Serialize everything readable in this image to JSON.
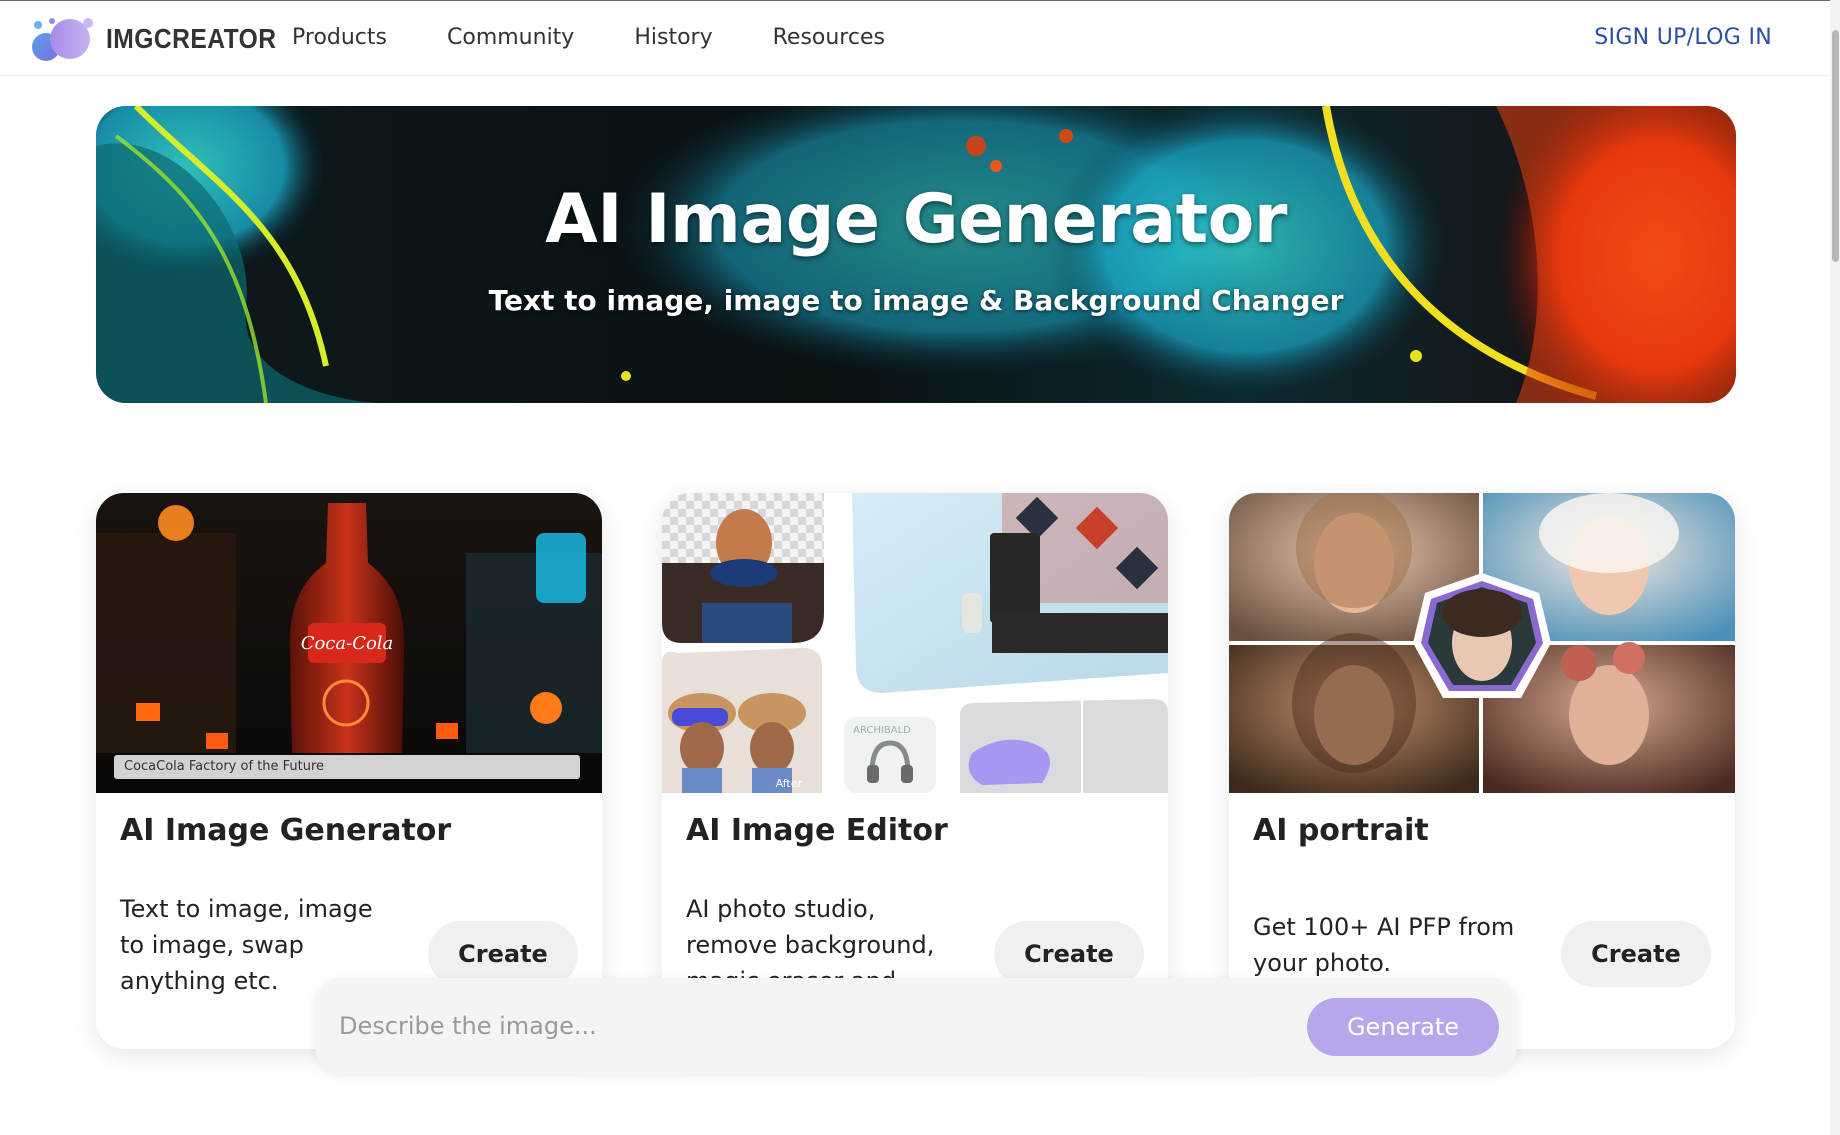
{
  "brand": {
    "name": "IMGCREATOR"
  },
  "nav": {
    "links": [
      "Products",
      "Community",
      "History",
      "Resources"
    ],
    "auth": "SIGN UP/LOG IN"
  },
  "hero": {
    "title": "AI Image Generator",
    "subtitle": "Text to image, image to image & Background Changer"
  },
  "cards": [
    {
      "title": "AI Image Generator",
      "description": "Text to image, image to image, swap anything etc.",
      "button": "Create",
      "image_caption": "CocaCola Factory of the Future",
      "image_label": "Coca-Cola"
    },
    {
      "title": "AI Image Editor",
      "description": "AI photo studio, remove background, magic eraser and more",
      "button": "Create",
      "image_labels": [
        "After",
        "ARCHIBALD"
      ]
    },
    {
      "title": "AI portrait",
      "description": "Get 100+ AI PFP from your photo.",
      "button": "Create"
    }
  ],
  "prompt": {
    "placeholder": "Describe the image...",
    "button": "Generate"
  },
  "colors": {
    "accent": "#b7a6ea",
    "link": "#2b4ea5",
    "button_bg": "#f0f0f0"
  }
}
